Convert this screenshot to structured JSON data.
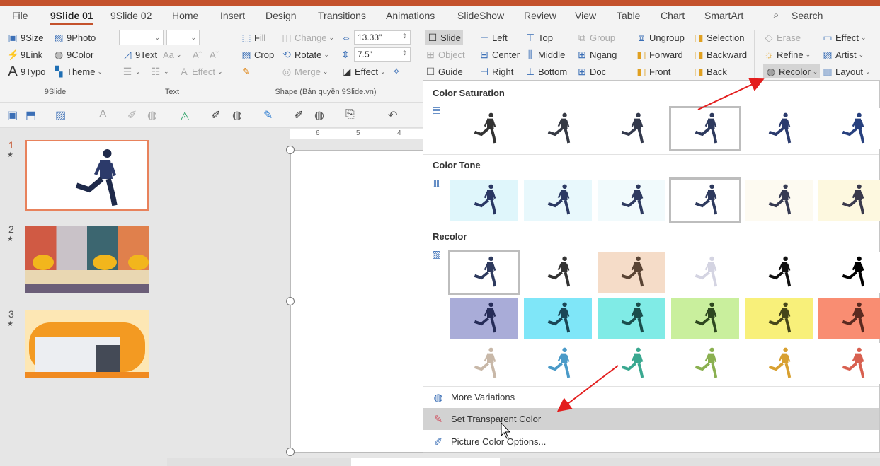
{
  "tabs": [
    {
      "label": "File"
    },
    {
      "label": "9Slide 01",
      "active": true
    },
    {
      "label": "9Slide 02"
    },
    {
      "label": "Home"
    },
    {
      "label": "Insert"
    },
    {
      "label": "Design"
    },
    {
      "label": "Transitions"
    },
    {
      "label": "Animations"
    },
    {
      "label": "SlideShow"
    },
    {
      "label": "Review"
    },
    {
      "label": "View"
    },
    {
      "label": "Table"
    },
    {
      "label": "Chart"
    },
    {
      "label": "SmartArt"
    }
  ],
  "search": {
    "label": "Search",
    "icon": "search-icon"
  },
  "accent": "#c4522c",
  "ribbon": {
    "columns": [
      [
        {
          "label": "9Size",
          "icon": "▣",
          "color": "#3b6fb6"
        },
        {
          "label": "9Link",
          "icon": "⚡",
          "color": "#e08a1e"
        },
        {
          "label": "9Typo",
          "icon": "A",
          "color": "#333"
        }
      ],
      [
        {
          "label": "9Photo",
          "icon": "▨",
          "color": "#3b6fb6"
        },
        {
          "label": "9Color",
          "icon": "◍",
          "color": "#666"
        },
        {
          "label": "Theme",
          "icon": "▚",
          "color": "#1f6fb4",
          "caret": true
        }
      ],
      [
        {
          "label": "Fill",
          "icon": "⬚",
          "color": "#3b6fb6"
        },
        {
          "label": "Crop",
          "icon": "▧",
          "color": "#3b6fb6"
        },
        {
          "label": "",
          "icon": "✎",
          "color": "#e08a1e"
        }
      ],
      [
        {
          "label": "Change",
          "icon": "◫",
          "color": "#aaa",
          "caret": true,
          "disabled": true
        },
        {
          "label": "Rotate",
          "icon": "⟲",
          "color": "#3b6fb6",
          "caret": true
        },
        {
          "label": "Merge",
          "icon": "◎",
          "color": "#aaa",
          "caret": true,
          "disabled": true
        }
      ],
      [
        {
          "label": "",
          "icon": "⇔",
          "color": "#3b6fb6"
        },
        {
          "label": "",
          "icon": "⇕",
          "color": "#3b6fb6"
        },
        {
          "label": "Effect",
          "icon": "◪",
          "color": "#333",
          "caret": true
        }
      ],
      [
        {
          "label": "Slide",
          "icon": "☐",
          "color": "#333",
          "highlight": true
        },
        {
          "label": "Object",
          "icon": "⊞",
          "color": "#aaa",
          "disabled": true
        },
        {
          "label": "Guide",
          "icon": "☐",
          "color": "#666"
        }
      ],
      [
        {
          "label": "Left",
          "icon": "⊢",
          "color": "#3b6fb6"
        },
        {
          "label": "Center",
          "icon": "⊟",
          "color": "#3b6fb6"
        },
        {
          "label": "Right",
          "icon": "⊣",
          "color": "#3b6fb6"
        }
      ],
      [
        {
          "label": "Top",
          "icon": "⊤",
          "color": "#3b6fb6"
        },
        {
          "label": "Middle",
          "icon": "⫼",
          "color": "#3b6fb6"
        },
        {
          "label": "Bottom",
          "icon": "⊥",
          "color": "#3b6fb6"
        }
      ],
      [
        {
          "label": "Group",
          "icon": "⧉",
          "color": "#aaa",
          "disabled": true
        },
        {
          "label": "Ngang",
          "icon": "⊞",
          "color": "#3b6fb6"
        },
        {
          "label": "Dọc",
          "icon": "⊞",
          "color": "#3b6fb6"
        }
      ],
      [
        {
          "label": "Ungroup",
          "icon": "⧈",
          "color": "#3b6fb6"
        },
        {
          "label": "Forward",
          "icon": "◧",
          "color": "#e0a020"
        },
        {
          "label": "Front",
          "icon": "◧",
          "color": "#e0a020"
        }
      ],
      [
        {
          "label": "Selection",
          "icon": "◨",
          "color": "#e0a020"
        },
        {
          "label": "Backward",
          "icon": "◨",
          "color": "#e0a020"
        },
        {
          "label": "Back",
          "icon": "◨",
          "color": "#e0a020"
        }
      ],
      [
        {
          "label": "Erase",
          "icon": "◇",
          "color": "#aaa",
          "disabled": true
        },
        {
          "label": "Refine",
          "icon": "☼",
          "color": "#e0a020",
          "caret": true
        },
        {
          "label": "Recolor",
          "icon": "◍",
          "color": "#555",
          "caret": true,
          "highlight": true
        }
      ],
      [
        {
          "label": "Effect",
          "icon": "▭",
          "color": "#3b6fb6",
          "caret": true
        },
        {
          "label": "Artist",
          "icon": "▨",
          "color": "#3b6fb6",
          "caret": true
        },
        {
          "label": "Layout",
          "icon": "▥",
          "color": "#3b6fb6",
          "caret": true
        }
      ]
    ],
    "text_group": {
      "text_label": "9Text",
      "aa": "Aa",
      "grow": "Aˆ",
      "shrink": "Aˇ",
      "effect": "Effect"
    },
    "width_value": "13.33\"",
    "height_value": "7.5\"",
    "groups": {
      "g9slide": "9Slide",
      "text": "Text",
      "shape": "Shape (Bản quyền 9Slide.vn)"
    }
  },
  "qat": [
    "▣",
    "⬒",
    "▨",
    "A",
    "✐",
    "◍",
    "◬",
    "✐",
    "◍",
    "✎",
    "✐",
    "◍",
    "⎘",
    "↶"
  ],
  "slides": [
    {
      "num": "1"
    },
    {
      "num": "2"
    },
    {
      "num": "3"
    }
  ],
  "ruler": [
    "6",
    "5",
    "4"
  ],
  "recolor_menu": {
    "sections": [
      {
        "title": "Color Saturation",
        "rows": [
          [
            {
              "bg": "#ffffff",
              "fig": "#333333"
            },
            {
              "bg": "#ffffff",
              "fig": "#363a44"
            },
            {
              "bg": "#ffffff",
              "fig": "#33394c"
            },
            {
              "bg": "#ffffff",
              "fig": "#2e3a5e",
              "selected": true
            },
            {
              "bg": "#ffffff",
              "fig": "#2b3b6e"
            },
            {
              "bg": "#ffffff",
              "fig": "#27407e"
            }
          ]
        ]
      },
      {
        "title": "Color Tone",
        "rows": [
          [
            {
              "bg": "#dff6fb",
              "fig": "#2a3864"
            },
            {
              "bg": "#e8f8fc",
              "fig": "#2c3a64"
            },
            {
              "bg": "#f1fafc",
              "fig": "#2e3a60"
            },
            {
              "bg": "#ffffff",
              "fig": "#2e3a5e",
              "selected": true
            },
            {
              "bg": "#fdfaf1",
              "fig": "#363a52"
            },
            {
              "bg": "#fdf8df",
              "fig": "#3a3a4c"
            }
          ]
        ]
      },
      {
        "title": "Recolor",
        "rows": [
          [
            {
              "bg": "#ffffff",
              "fig": "#2e3a5e",
              "selected": true
            },
            {
              "bg": "#ffffff",
              "fig": "#333333"
            },
            {
              "bg": "#f5dcc8",
              "fig": "#5a4434"
            },
            {
              "bg": "#ffffff",
              "fig": "#d4d4e2"
            },
            {
              "bg": "#ffffff",
              "fig": "#111111"
            },
            {
              "bg": "#ffffff",
              "fig": "#000000"
            }
          ],
          [
            {
              "bg": "#a9acd8",
              "fig": "#262c58"
            },
            {
              "bg": "#7fe6f8",
              "fig": "#1a4656"
            },
            {
              "bg": "#80ebe6",
              "fig": "#1a4e4c"
            },
            {
              "bg": "#c9ef9d",
              "fig": "#2e4820"
            },
            {
              "bg": "#f8f07a",
              "fig": "#46461a"
            },
            {
              "bg": "#f98d72",
              "fig": "#5a2a20"
            }
          ],
          [
            {
              "bg": "#ffffff",
              "fig": "#c8b8a8"
            },
            {
              "bg": "#ffffff",
              "fig": "#4a9ac8"
            },
            {
              "bg": "#ffffff",
              "fig": "#3aa890"
            },
            {
              "bg": "#ffffff",
              "fig": "#8ab050"
            },
            {
              "bg": "#ffffff",
              "fig": "#d8a030"
            },
            {
              "bg": "#ffffff",
              "fig": "#d86050"
            }
          ]
        ]
      }
    ],
    "items": [
      {
        "label": "More Variations",
        "icon": "◍"
      },
      {
        "label": "Set Transparent Color",
        "icon": "✎",
        "hover": true
      },
      {
        "label": "Picture Color Options...",
        "icon": "✐"
      }
    ]
  },
  "annotation_color": "#e31e1e"
}
